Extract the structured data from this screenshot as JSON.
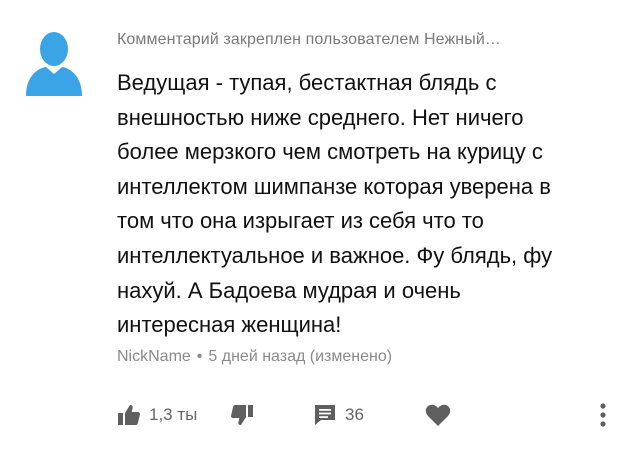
{
  "comment": {
    "pinned_label": "Комментарий закреплен пользователем Нежный…",
    "text_lines": [
      "Ведущая - тупая, бестактная блядь с",
      "внешностью ниже среднего. Нет ничего",
      "более мерзкого чем смотреть на курицу с",
      "интеллектом шимпанзе которая уверена в",
      "том что она изрыгает из себя что то",
      "интеллектуальное и важное. Фу блядь, фу",
      "нахуй. А Бадоева мудрая и очень",
      "интересная женщина!"
    ],
    "author": "NickName",
    "separator": "•",
    "time": "5 дней назад (изменено)"
  },
  "actions": {
    "like_count": "1,3 ты",
    "reply_count": "36"
  },
  "icons": {
    "avatar": "user-avatar-icon",
    "like": "thumbs-up-icon",
    "dislike": "thumbs-down-icon",
    "reply": "comment-icon",
    "heart": "heart-icon",
    "more": "more-vertical-icon"
  },
  "colors": {
    "avatar_blue": "#3ba4e6",
    "icon_gray": "#5f5f5f",
    "meta_gray": "#8a8a8a"
  }
}
